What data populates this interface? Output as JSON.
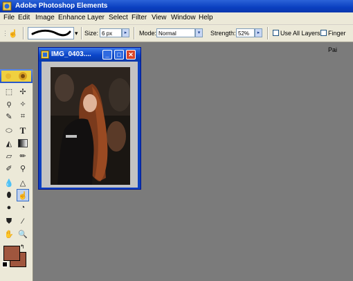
{
  "app": {
    "title": "Adobe Photoshop Elements"
  },
  "menu": [
    "File",
    "Edit",
    "Image",
    "Enhance",
    "Layer",
    "Select",
    "Filter",
    "View",
    "Window",
    "Help"
  ],
  "options": {
    "size_label": "Size:",
    "size_value": "6 px",
    "mode_label": "Mode:",
    "mode_value": "Normal",
    "strength_label": "Strength:",
    "strength_value": "52%",
    "use_all_layers": "Use All Layers",
    "finger_painting": "Finger Pai"
  },
  "document": {
    "title": "IMG_0403...."
  },
  "colors": {
    "foreground": "#a0563e",
    "background": "#a0563e",
    "accent": "#0a3fc0"
  },
  "tools": [
    "marquee-icon",
    "move-icon",
    "lasso-icon",
    "magic-wand-icon",
    "selection-brush-icon",
    "crop-icon",
    "shape-icon",
    "type-icon",
    "paint-bucket-icon",
    "gradient-icon",
    "eraser-icon",
    "pencil-icon",
    "brush-icon",
    "clone-stamp-icon",
    "blur-icon",
    "sharpen-icon",
    "sponge-icon",
    "smudge-icon",
    "dodge-icon",
    "burn-icon",
    "red-eye-icon",
    "eyedropper-icon",
    "hand-icon",
    "zoom-icon"
  ]
}
